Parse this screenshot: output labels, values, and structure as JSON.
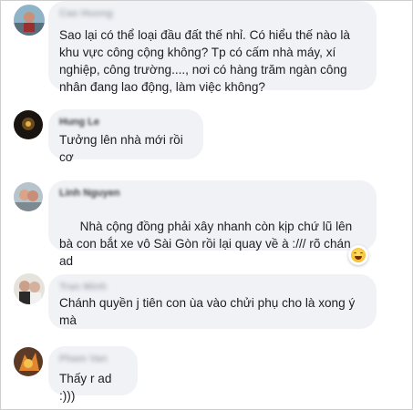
{
  "comments": [
    {
      "author": "Cao Huong",
      "text": "Sao lại có thể loại đầu đất thế nhỉ. Có hiểu thế nào là khu vực công cộng không? Tp có cấm nhà máy, xí nghiệp, công trường...., nơi có hàng trăm ngàn công nhân đang lao động, làm việc không?",
      "avatar_icon": "user-avatar-icon",
      "emoji": ""
    },
    {
      "author": "Hung Le",
      "text": "Tưởng lên nhà mới rồi cơ",
      "avatar_icon": "user-avatar-icon",
      "emoji": ""
    },
    {
      "author": "Linh Nguyen",
      "text": "Nhà cộng đồng phải xây nhanh còn kịp chứ lũ lên bà con bắt xe vô Sài Gòn rồi lại quay về à :/// rõ chán ad",
      "avatar_icon": "user-avatar-icon",
      "emoji": "grin-emoji",
      "reaction": "haha-reaction-icon"
    },
    {
      "author": "Tran Minh",
      "text": "Chánh quyền j tiên con ùa vào chửi phụ cho là xong ý mà",
      "avatar_icon": "user-avatar-icon",
      "emoji": ""
    },
    {
      "author": "Pham Van",
      "text": "Thấy r ad :)))",
      "avatar_icon": "user-avatar-icon",
      "emoji": ""
    }
  ]
}
